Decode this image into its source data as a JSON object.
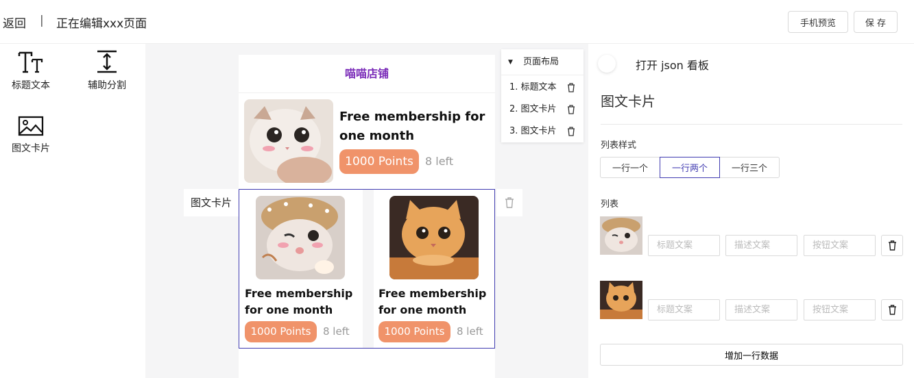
{
  "header": {
    "back_label": "返回",
    "divider": "|",
    "title": "正在编辑xxx页面",
    "preview_label": "手机预览",
    "save_label": "保 存"
  },
  "palette": {
    "items": [
      {
        "label": "标题文本",
        "icon": "text-title-icon"
      },
      {
        "label": "辅助分割",
        "icon": "vertical-divider-icon"
      },
      {
        "label": "图文卡片",
        "icon": "image-icon"
      }
    ]
  },
  "canvas": {
    "shop_title": "喵喵店铺",
    "card1": {
      "title": "Free membership for one month",
      "points": "1000 Points",
      "left": "8 left"
    },
    "card_grid": [
      {
        "title": "Free membership for one month",
        "points": "1000 Points",
        "left": "8 left"
      },
      {
        "title": "Free membership for one month",
        "points": "1000 Points",
        "left": "8 left"
      }
    ],
    "selected_label": "图文卡片"
  },
  "layout_panel": {
    "title": "页面布局",
    "items": [
      "1. 标题文本",
      "2. 图文卡片",
      "3. 图文卡片"
    ]
  },
  "settings": {
    "json_toggle_label": "打开 json 看板",
    "json_toggle_on": false,
    "section_title": "图文卡片",
    "list_style_label": "列表样式",
    "list_styles": [
      "一行一个",
      "一行两个",
      "一行三个"
    ],
    "selected_list_style": "一行两个",
    "list_label": "列表",
    "rows": [
      {
        "title_placeholder": "标题文案",
        "desc_placeholder": "描述文案",
        "button_placeholder": "按钮文案"
      },
      {
        "title_placeholder": "标题文案",
        "desc_placeholder": "描述文案",
        "button_placeholder": "按钮文案"
      }
    ],
    "add_row_label": "增加一行数据"
  },
  "colors": {
    "accent": "#3f3ab0",
    "points_pill": "#f0936a",
    "shop_title": "#7a2bb8",
    "canvas_bg": "#f5f5f6"
  }
}
